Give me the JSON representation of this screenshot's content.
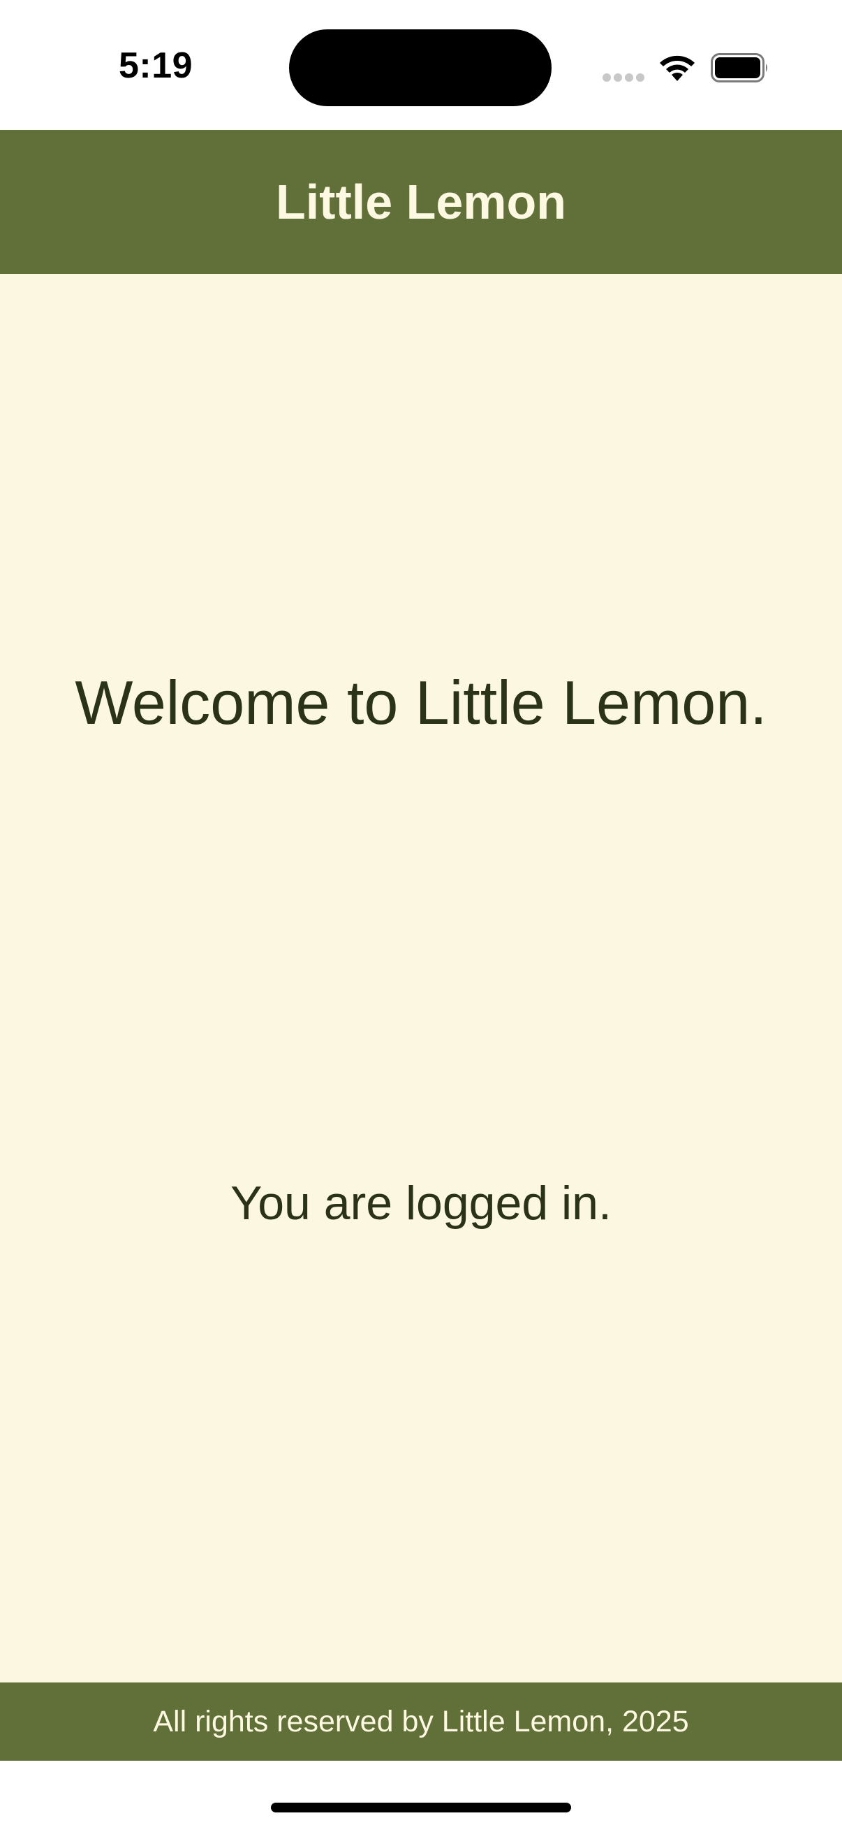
{
  "status_bar": {
    "time": "5:19",
    "icons": [
      "signal-dots-icon",
      "wifi-icon",
      "battery-icon"
    ]
  },
  "header": {
    "title": "Little Lemon"
  },
  "main": {
    "welcome": "Welcome to Little Lemon.",
    "status_message": "You are logged in."
  },
  "footer": {
    "text": "All rights reserved by Little Lemon, 2025"
  },
  "colors": {
    "brand_green": "#616F38",
    "background_cream": "#FCF7E0",
    "header_text": "#FDF8E1",
    "body_text": "#2A3317"
  }
}
